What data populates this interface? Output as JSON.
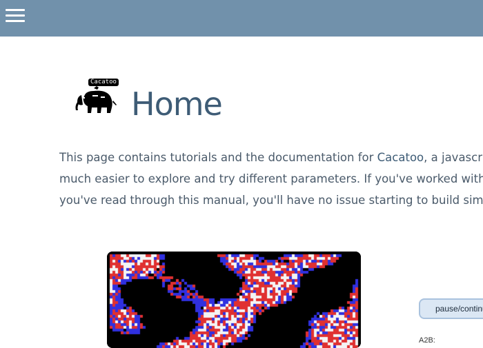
{
  "header": {
    "menu_icon": "hamburger-menu-icon",
    "background": "#7191ab"
  },
  "logo": {
    "bubble_text": "Cacatoo",
    "icon": "elephant-logo-icon"
  },
  "page": {
    "title": "Home",
    "title_color": "#3e5c76"
  },
  "intro": {
    "line1_prefix": "This page contains tutorials and the documentation for ",
    "link_text": "Cacatoo",
    "line1_suffix": ", a javascri",
    "line2": "much easier to explore and try different parameters. If you've worked with",
    "line3": "you've read through this manual, you'll have no issue starting to build sim"
  },
  "simulation": {
    "colors": [
      "#000000",
      "#3030e0",
      "#e03030",
      "#f4f4f4"
    ]
  },
  "controls": {
    "pause_label": "pause/continu",
    "param_label": "A2B:"
  }
}
